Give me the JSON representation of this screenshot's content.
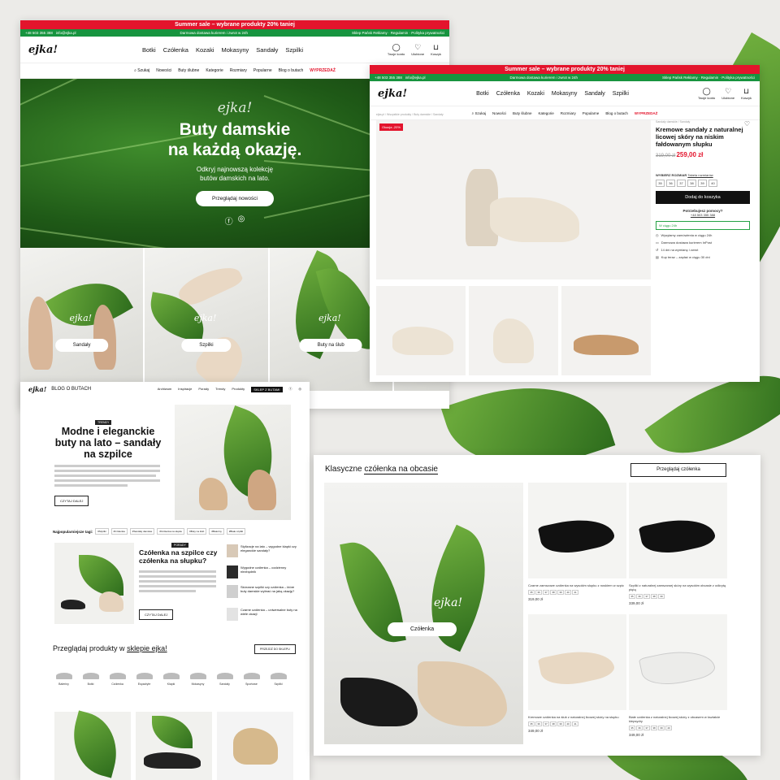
{
  "promo": "Summer sale – wybrane produkty 20% taniej",
  "colors": {
    "red": "#e3142c",
    "green": "#17943f"
  },
  "topbar": {
    "phone": "+48 503 355 388",
    "email": "info@ejka.pl",
    "shipping": "Darmowa dostawa kurierem i zwrot w 24h",
    "links": "Sklep Pańsk Reklamy · Regulamin · Polityka prywatności"
  },
  "logo": "ejka!",
  "main_nav": [
    "Botki",
    "Czółenka",
    "Kozaki",
    "Mokasyny",
    "Sandały",
    "Szpilki"
  ],
  "header_icons": [
    {
      "icon": "user-icon",
      "label": "Twoje konto"
    },
    {
      "icon": "heart-icon",
      "label": "Ulubione"
    },
    {
      "icon": "bag-icon",
      "label": "Koszyk"
    }
  ],
  "sub_nav": [
    "Szukaj",
    "Nowości",
    "Buty ślubne",
    "Kategorie",
    "Rozmiary",
    "Popularne",
    "Blog o butach",
    "WYPRZEDAŻ"
  ],
  "hero": {
    "logo": "ejka!",
    "title_1": "Buty damskie",
    "title_2": "na każdą okazję.",
    "text_1": "Odkryj najnowszą kolekcję",
    "text_2": "butów damskich na lato.",
    "button": "Przeglądaj nowości"
  },
  "tiles": [
    "Sandały",
    "Szpilki",
    "Buty na ślub"
  ],
  "product": {
    "badge": "Okazja -20%",
    "breadcrumbs": "ejka.pl / Wszystkie produkty / Buty damskie / Sandały",
    "brand": "Sandały damskie / Sandały",
    "name": "Kremowe sandały z naturalnej licowej skóry na niskim fałdowanym słupku",
    "old_price": "319,00 zł",
    "new_price": "259,00 zł",
    "size_label": "WYBIERZ ROZMIAR",
    "size_table": "Tabela rozmiarów",
    "sizes": [
      "35",
      "36",
      "37",
      "38",
      "39",
      "40"
    ],
    "add_to_cart": "Dodaj do koszyka",
    "help_title": "Potrzebujesz pomocy?",
    "help_phone": "+48 503 355 388",
    "availability": "W ciągu 24h",
    "features": [
      "Wysyłamy zamówienia w ciągu 24h",
      "Darmowa dostawa kurierem InPost",
      "14 dni na wymianę i zwrot",
      "Kup teraz – zapłać w ciągu 30 dni"
    ]
  },
  "blog": {
    "logo": "ejka!",
    "title": "BLOG O BUTACH",
    "nav": [
      "Archiwum",
      "Inspiracje",
      "Porady",
      "Trendy",
      "Produkty"
    ],
    "shop_button": "SKLEP Z BUTAMI",
    "tag": "TRENDY",
    "headline_1": "Modne i eleganckie",
    "headline_2": "buty na lato – sandały",
    "headline_3": "na szpilce",
    "read_more": "CZYTAJ DALEJ",
    "tags_label": "Najpopularniejsze tagi:",
    "tags": [
      "#Szpilki",
      "#Czółenka",
      "#Sandały damskie",
      "#Czółenka na słupku",
      "#Buty na ślub",
      "#Baleriny",
      "#Białe szpilki"
    ],
    "article_tag": "PORADY",
    "article_1": "Czółenka na szpilce czy",
    "article_2": "czółenka na słupku?",
    "side_posts": [
      "Stylizacje na lato – wygodne klapki czy eleganckie sandały?",
      "Wygodne czółenka – codzienny niezbędnik",
      "Skórzane szpilki czy czółenka – które buty damskie wybrać na jaką okazję?",
      "Czarne czółenka – uniwersalne buty na wiele okazji"
    ],
    "browse_label": "Przeglądaj produkty w",
    "browse_link": "sklepie ejka!",
    "browse_button": "PRZEJDŹ DO SKLEPU",
    "categories": [
      "Baleriny",
      "Botki",
      "Czółenka",
      "Espadryle",
      "Klapki",
      "Mokasyny",
      "Sandały",
      "Sportowe",
      "Szpilki"
    ]
  },
  "pumps": {
    "title_a": "Klasyczne",
    "title_b": "czółenka na obcasie",
    "button": "Przeglądaj czółenka",
    "banner_logo": "ejka!",
    "banner_label": "Czółenka",
    "products": [
      {
        "name": "Czarne zamszowe czółenka na wysokim słupku z noskiem w szpic",
        "sizes": [
          "35",
          "36",
          "37",
          "38",
          "39",
          "40",
          "41"
        ],
        "price": "319,00 zł"
      },
      {
        "name": "Szpilki z naturalnej zamszowej skóry na wysokim obcasie z odkrytą piętą",
        "sizes": [
          "35",
          "36",
          "37",
          "38",
          "39"
        ],
        "price": "339,00 zł"
      },
      {
        "name": "Kremowe czółenka na ślub z naturalnej licowej skóry na słupku",
        "sizes": [
          "35",
          "36",
          "37",
          "38",
          "39",
          "40",
          "41"
        ],
        "price": "349,00 zł"
      },
      {
        "name": "Białe czółenka z naturalnej licowej skóry z obcasem w kształcie klepsydry",
        "sizes": [
          "35",
          "36",
          "37",
          "38",
          "39",
          "40"
        ],
        "price": "349,00 zł"
      }
    ]
  }
}
